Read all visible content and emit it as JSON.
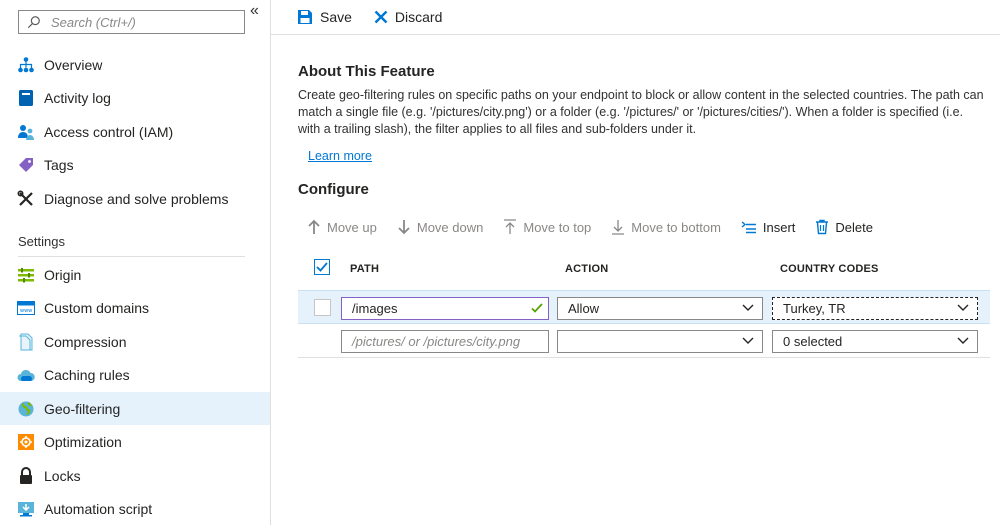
{
  "sidebar": {
    "search_placeholder": "Search (Ctrl+/)",
    "collapse_glyph": "«",
    "items_top": [
      {
        "label": "Overview",
        "icon": "overview-icon"
      },
      {
        "label": "Activity log",
        "icon": "activity-log-icon"
      },
      {
        "label": "Access control (IAM)",
        "icon": "iam-icon"
      },
      {
        "label": "Tags",
        "icon": "tag-icon"
      },
      {
        "label": "Diagnose and solve problems",
        "icon": "wrench-icon"
      }
    ],
    "settings_heading": "Settings",
    "items_settings": [
      {
        "label": "Origin",
        "icon": "origin-icon"
      },
      {
        "label": "Custom domains",
        "icon": "custom-domains-icon"
      },
      {
        "label": "Compression",
        "icon": "compression-icon"
      },
      {
        "label": "Caching rules",
        "icon": "caching-icon"
      },
      {
        "label": "Geo-filtering",
        "icon": "globe-icon",
        "active": true
      },
      {
        "label": "Optimization",
        "icon": "optimization-icon"
      },
      {
        "label": "Locks",
        "icon": "lock-icon"
      },
      {
        "label": "Automation script",
        "icon": "automation-icon"
      }
    ]
  },
  "toolbar": {
    "save_label": "Save",
    "discard_label": "Discard"
  },
  "about": {
    "title": "About This Feature",
    "text": "Create geo-filtering rules on specific paths on your endpoint to block or allow content in the selected countries. The path can match a single file (e.g. '/pictures/city.png') or a folder (e.g. '/pictures/' or '/pictures/cities/'). When a folder is specified (i.e. with a trailing slash), the filter applies to all files and sub-folders under it.",
    "learn_more": "Learn more"
  },
  "configure": {
    "title": "Configure",
    "actions": {
      "move_up": "Move up",
      "move_down": "Move down",
      "move_to_top": "Move to top",
      "move_to_bottom": "Move to bottom",
      "insert": "Insert",
      "delete": "Delete"
    },
    "columns": {
      "path": "PATH",
      "action": "ACTION",
      "country_codes": "COUNTRY CODES"
    },
    "rows": [
      {
        "path": "/images",
        "action": "Allow",
        "country": "Turkey, TR"
      },
      {
        "path_placeholder": "/pictures/ or /pictures/city.png",
        "action": "",
        "country": "0 selected"
      }
    ]
  },
  "colors": {
    "accent": "#0078d4",
    "active_bg": "#e5f1fb",
    "valid_check": "#57a300"
  }
}
